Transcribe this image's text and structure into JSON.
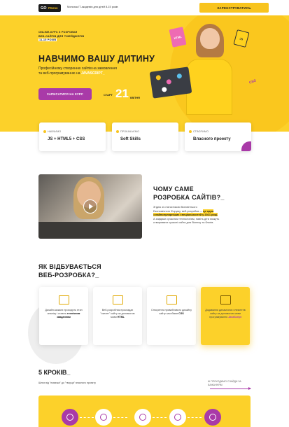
{
  "header": {
    "logo_go": "GO",
    "logo_it": "ITeens",
    "tagline": "Монохак IT-академія для дітей 8-15 років",
    "register_label": "ЗАРЕЄСТРУВАТИСЬ"
  },
  "hero": {
    "small_line_1": "ONLINE-КУРС З РОЗРОБКИ",
    "small_line_2": "ВЕБ-САЙТІВ ДЛЯ ТІНЕЙДЖЕРІВ",
    "small_line_3": "11-15 РОКІВ",
    "title": "НАВЧИМО ВАШУ ДИТИНУ",
    "subtitle_1": "Професійному створенню сайтів на замовлення",
    "subtitle_2": "та веб-програмуванню на",
    "subtitle_hl": "JAVASCRIPT_",
    "signup_label": "ЗАПИСАТИСЯ НА КУРС",
    "start_label": "СТАРТ",
    "start_day": "21",
    "start_month": "КВІТНЯ",
    "badge_html": "HTML",
    "badge_js": "JS",
    "badge_css": "CSS",
    "accent_color": "#fcd12a",
    "purple_color": "#a93aa8"
  },
  "features": [
    {
      "label": "НАВЧИМО",
      "value": "JS + HTML5 + CSS"
    },
    {
      "label": "ПРОКАЧАЄМО",
      "value": "Soft Skills"
    },
    {
      "label": "СТВОРИМО",
      "value": "Власного проекту"
    }
  ],
  "why": {
    "title_1": "ЧОМУ САМЕ",
    "title_2": "РОЗРОБКА САЙТІВ?_",
    "text_1": "Згідно зі статистикою Всесвітнього",
    "text_2": "Економічного Форуму, веб-розробка —",
    "text_hl_1": "це одна",
    "text_hl_2": "з найпопулярніших спеціальностей у 2021 році.",
    "text_3": "А завдяки сучасним технологіям, навіть діти можуть",
    "text_4": "створювати сучасні сайти для бізнесу та блогів."
  },
  "how": {
    "title_1": "ЯК ВІДБУВАЄТЬСЯ",
    "title_2": "ВЕБ-РОЗРОБКА?_",
    "steps": [
      {
        "text": "Дизайн-мокапи проходять етап аналізу і стають",
        "bold": "технічним завданням"
      },
      {
        "text": "Веб-розробник прокладає \"скелет\" сайту за допомогою мови",
        "bold": "HTML"
      },
      {
        "text": "Створення привабливого дизайну сайту засобами",
        "bold": "CSS"
      },
      {
        "text": "Додавання динамічних елементів сайту за допомогою мови програмування",
        "bold": "JavaScript"
      }
    ]
  },
  "five": {
    "title": "5 КРОКІВ_",
    "subtitle": "Шлях від \"новачка\" до \"творця\" власного проекту",
    "note": "Ж ПРОХОДИМО СЛАЙДИ ЗА БАЖАННЯМ"
  }
}
